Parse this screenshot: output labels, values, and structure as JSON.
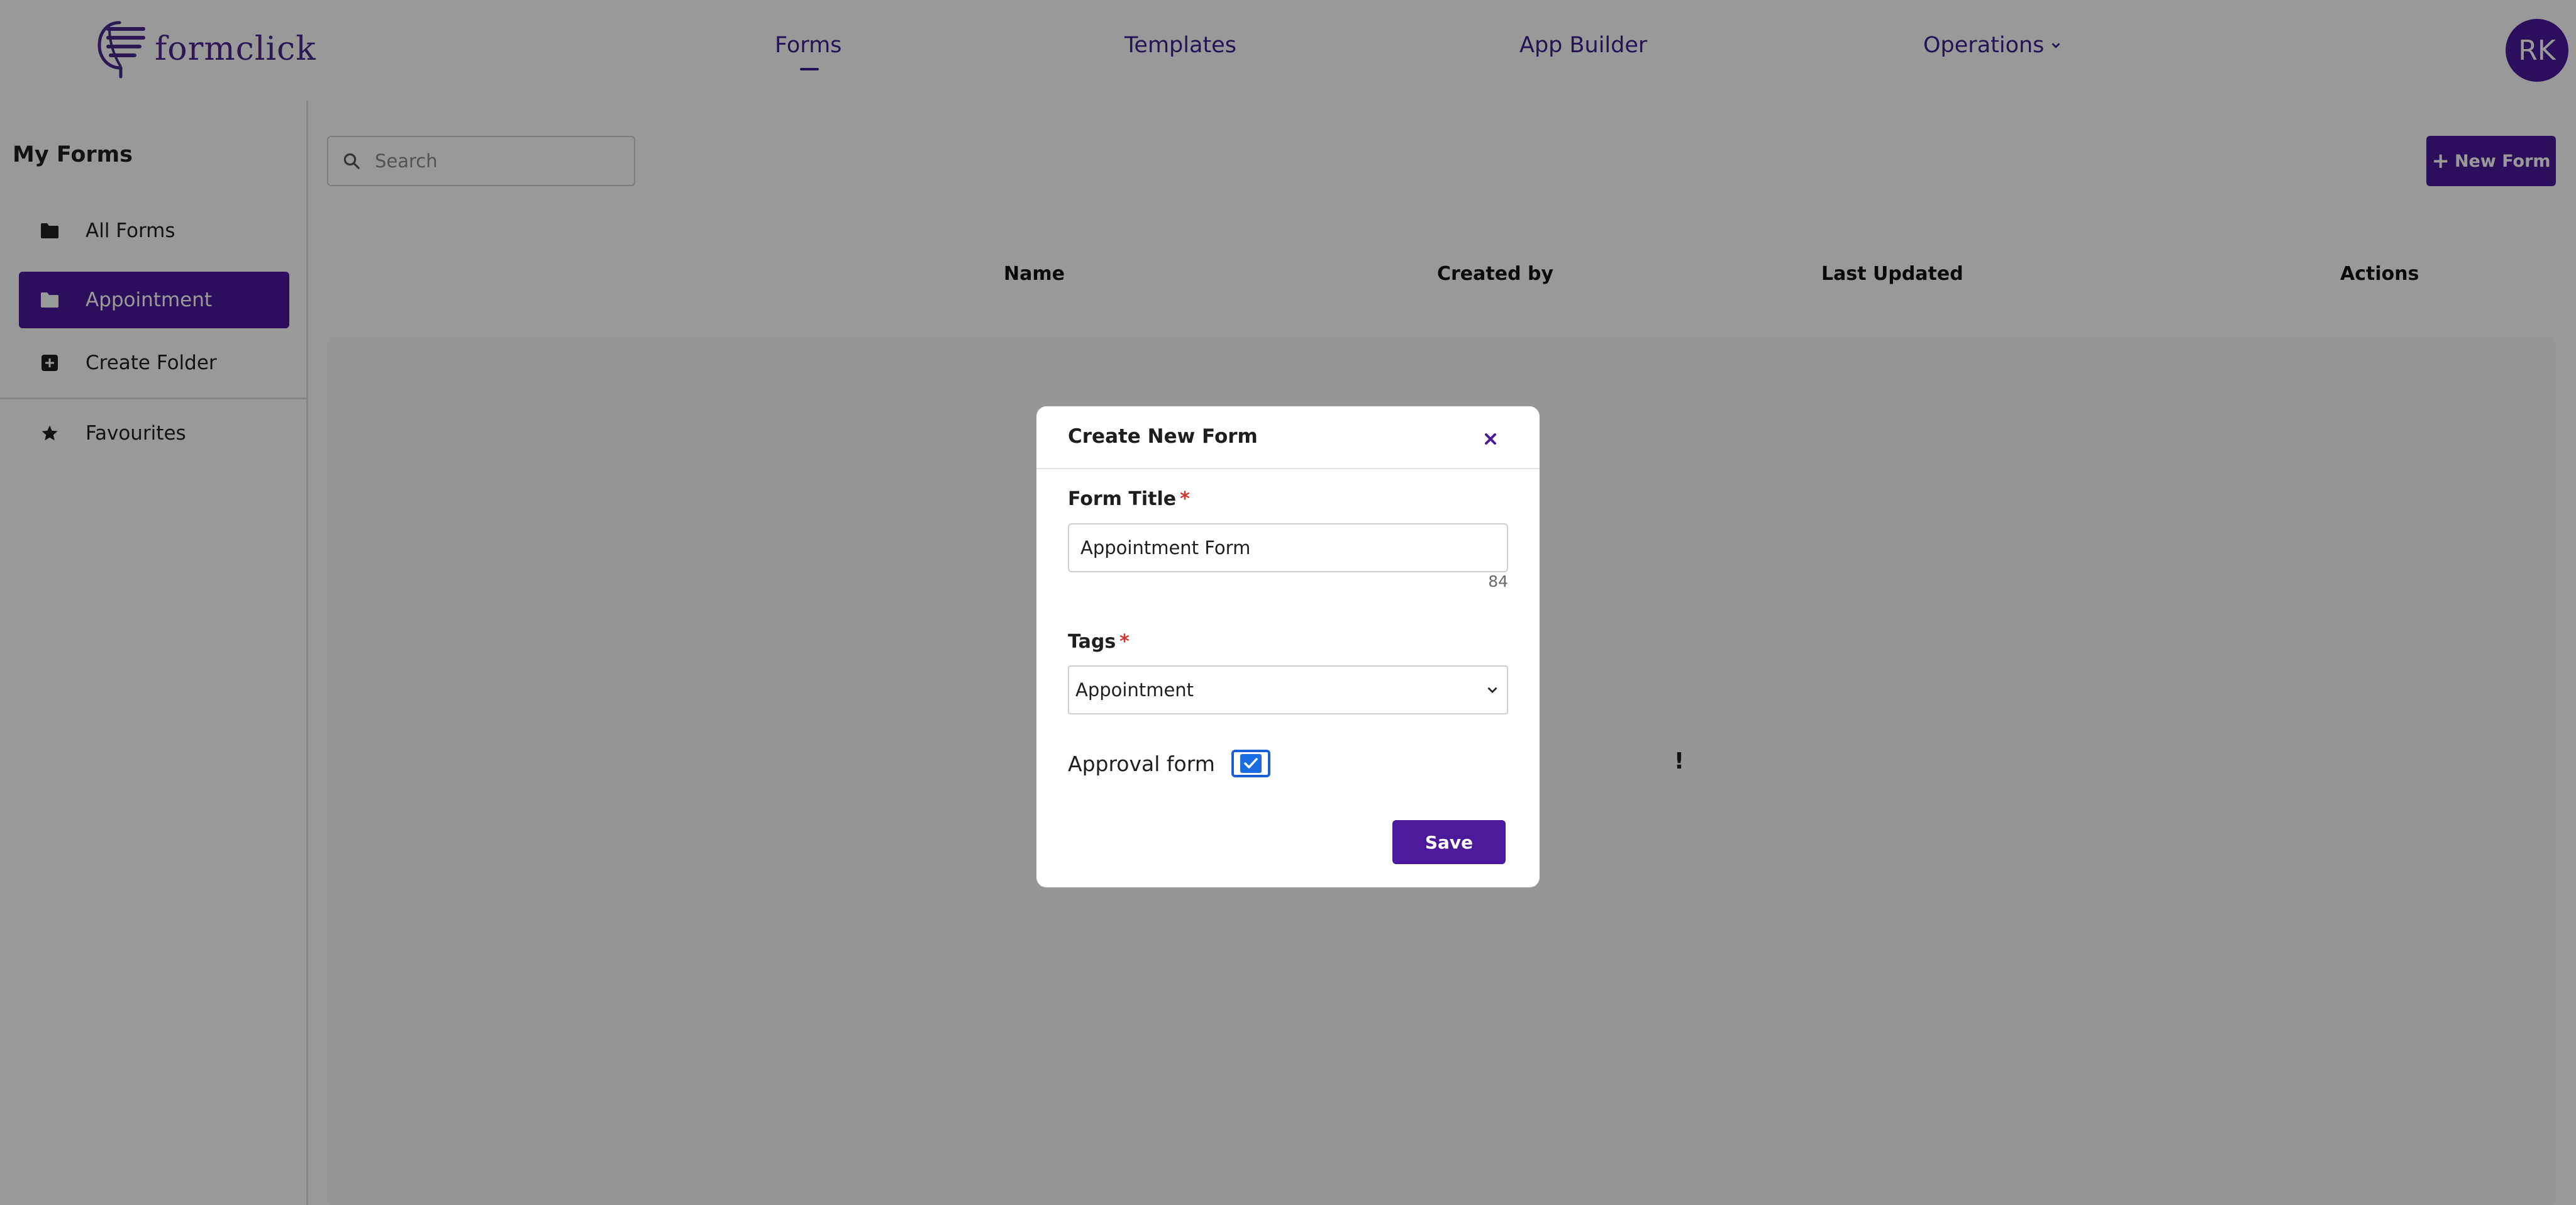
{
  "app": {
    "logo_text": "formclick",
    "avatar_initials": "RK"
  },
  "nav": {
    "forms": "Forms",
    "templates": "Templates",
    "app_builder": "App Builder",
    "operations": "Operations"
  },
  "sidebar": {
    "title": "My Forms",
    "items": [
      {
        "label": "All Forms",
        "icon": "folder-icon"
      },
      {
        "label": "Appointment",
        "icon": "folder-icon",
        "active": true
      },
      {
        "label": "Create Folder",
        "icon": "plus-square-icon"
      },
      {
        "label": "Favourites",
        "icon": "star-icon"
      }
    ]
  },
  "search": {
    "placeholder": "Search",
    "value": ""
  },
  "toolbar": {
    "new_form_label": "New Form"
  },
  "table": {
    "columns": [
      "Name",
      "Created by",
      "Last Updated",
      "Actions"
    ]
  },
  "main": {
    "empty_message_visible_fragment": "!"
  },
  "modal": {
    "title": "Create New Form",
    "form_title_label": "Form Title",
    "form_title_value": "Appointment Form",
    "char_count": "84",
    "tags_label": "Tags",
    "tags_value": "Appointment",
    "approval_label": "Approval form",
    "approval_checked": true,
    "save_label": "Save",
    "required_marker": "*"
  },
  "colors": {
    "brand": "#4a1a9a",
    "nav_text": "#3d1f8c",
    "required": "#d0342c",
    "checkbox": "#1a6ce0"
  }
}
